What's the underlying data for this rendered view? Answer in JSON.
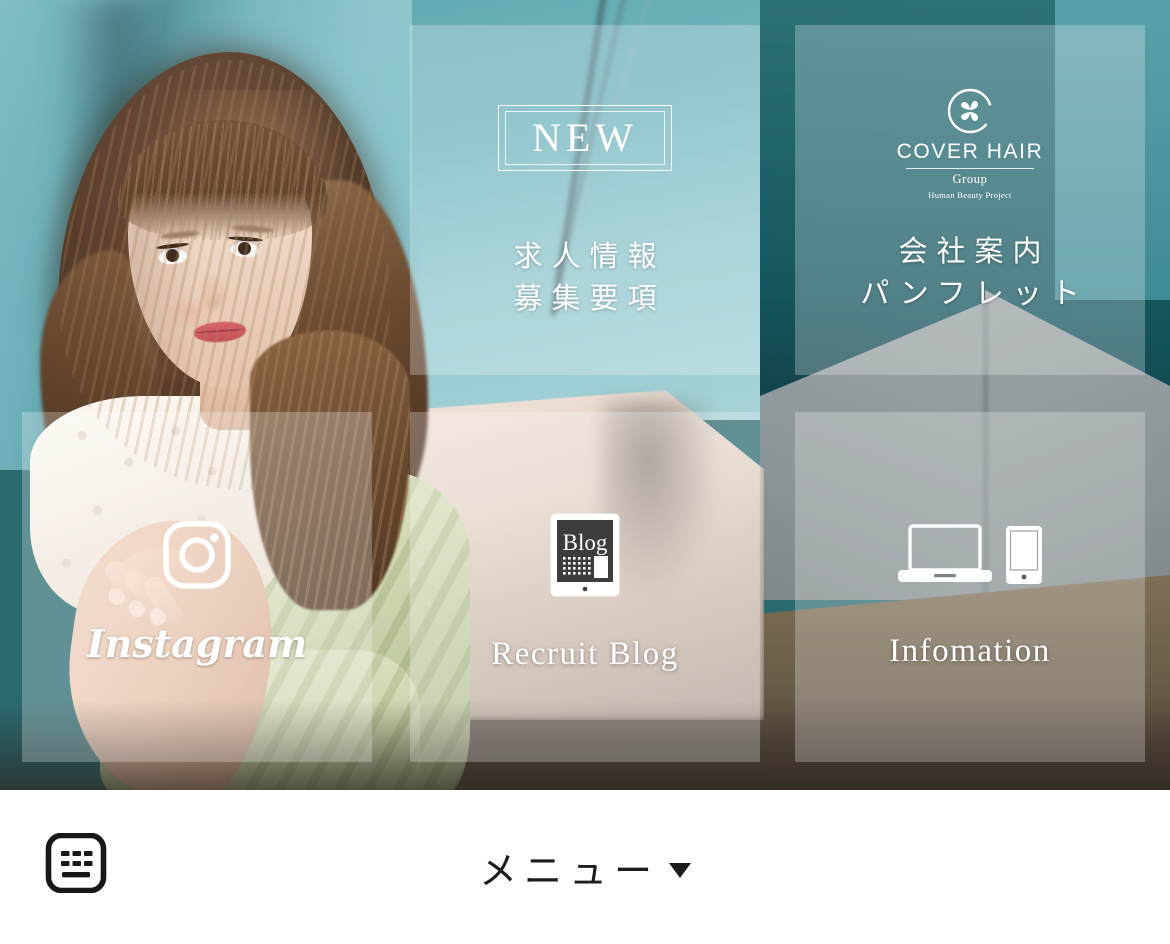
{
  "page": {
    "title": "COVER HAIR Group Recruit"
  },
  "tiles": {
    "recruit": {
      "badge": "NEW",
      "line1": "求人情報",
      "line2": "募集要項",
      "icon": "new-badge"
    },
    "company": {
      "logo_word": "COVER HAIR",
      "logo_group": "Group",
      "logo_tagline": "Human Beauty Project",
      "logo_icon": "clover-hearts-icon",
      "line1": "会社案内",
      "line2": "パンフレット"
    },
    "instagram": {
      "label": "Instagram",
      "icon": "instagram-icon"
    },
    "blog": {
      "label": "Recruit Blog",
      "icon": "tablet-blog-icon",
      "icon_text": "Blog"
    },
    "information": {
      "label": "Infomation",
      "icon_laptop": "laptop-icon",
      "icon_phone": "smartphone-icon"
    }
  },
  "bottom_bar": {
    "keyboard_icon": "keyboard-icon",
    "menu_label": "メニュー",
    "menu_caret": "▼"
  },
  "colors": {
    "tile_overlay": "rgba(255,255,255,0.26)",
    "text_on_photo": "#ffffff",
    "bar_background": "#ffffff",
    "bar_text": "#1c1c1c",
    "wall_teal": "#4f9099",
    "wall_teal_dark": "#14555c",
    "floor_tan": "#6c5f49",
    "skirt_sage": "#c2cf9f"
  }
}
